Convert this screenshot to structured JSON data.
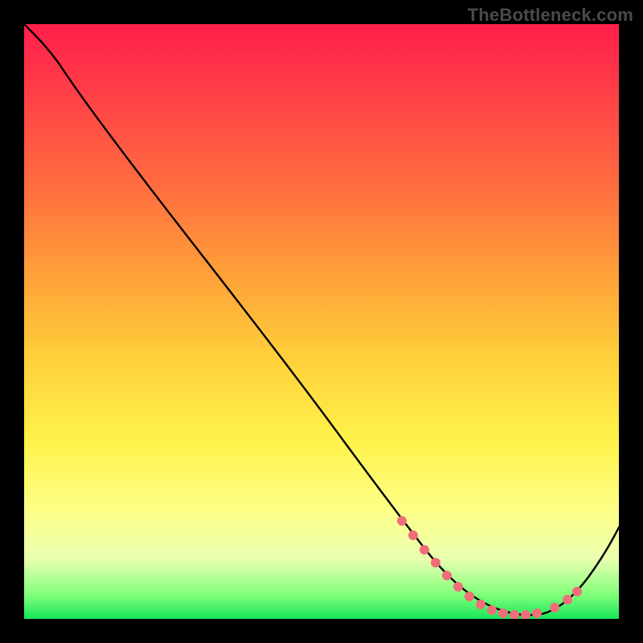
{
  "watermark": "TheBottleneck.com",
  "chart_data": {
    "type": "line",
    "title": "",
    "xlabel": "",
    "ylabel": "",
    "xlim": [
      0,
      100
    ],
    "ylim": [
      0,
      100
    ],
    "series": [
      {
        "name": "curve",
        "x": [
          0,
          4,
          8,
          12,
          18,
          26,
          34,
          42,
          50,
          58,
          62,
          66,
          70,
          74,
          78,
          82,
          84,
          86,
          90,
          94,
          100
        ],
        "y": [
          100,
          97,
          94,
          90,
          84,
          74,
          63,
          52,
          41,
          30,
          24,
          18,
          12,
          7,
          3.5,
          1.5,
          1,
          1.2,
          3,
          7,
          16
        ]
      },
      {
        "name": "optimal-band-markers",
        "x": [
          62,
          65,
          67,
          69,
          71,
          73,
          75,
          77,
          79,
          81,
          83,
          85,
          87,
          89
        ],
        "y": [
          24,
          19,
          16,
          13,
          10,
          7.5,
          5.5,
          4,
          3,
          2,
          1.5,
          1.2,
          1.5,
          2.5
        ]
      }
    ],
    "colors": {
      "curve": "#000000",
      "markers": "#ef6e7a",
      "gradient_top": "#ff1f4b",
      "gradient_bottom": "#17e65a"
    },
    "background": "rainbow-vertical-gradient",
    "annotations": []
  }
}
